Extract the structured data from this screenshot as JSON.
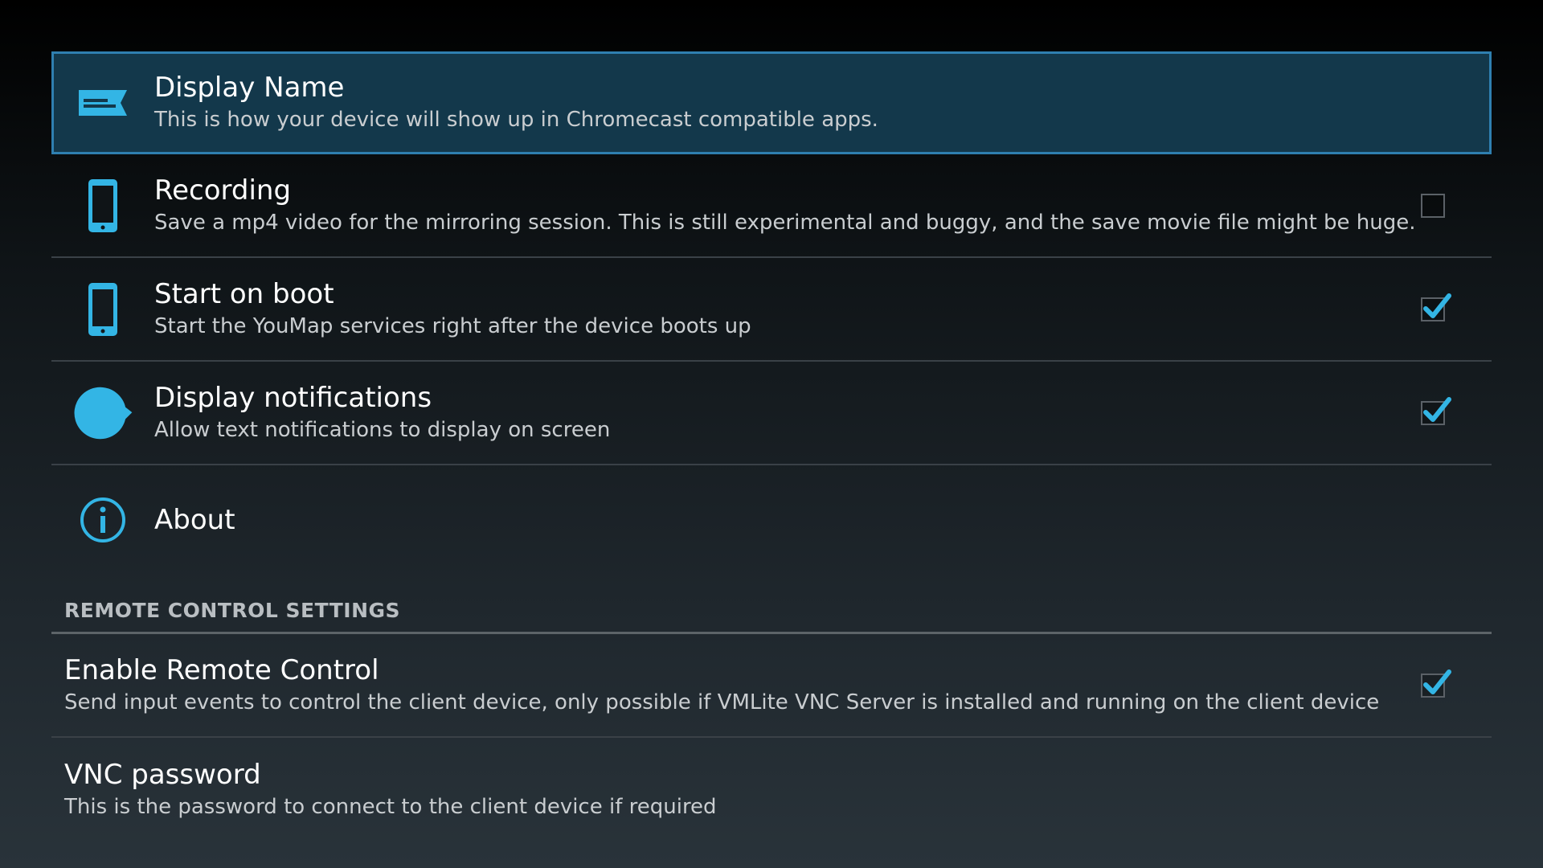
{
  "settings": {
    "items": [
      {
        "title": "Display Name",
        "summary": "This is how your device will show up in Chromecast compatible apps.",
        "icon": "label-icon"
      },
      {
        "title": "Recording",
        "summary": "Save a mp4 video for the mirroring session. This is still experimental and buggy, and the save movie file might be huge.",
        "icon": "phone-icon",
        "checked": false
      },
      {
        "title": "Start on boot",
        "summary": "Start the YouMap services right after the device boots up",
        "icon": "phone-icon",
        "checked": true
      },
      {
        "title": "Display notifications",
        "summary": "Allow text notifications to display on screen",
        "icon": "chat-bubble-icon",
        "checked": true
      },
      {
        "title": "About",
        "icon": "info-icon"
      }
    ]
  },
  "remote_section": {
    "header": "REMOTE CONTROL SETTINGS",
    "items": [
      {
        "title": "Enable Remote Control",
        "summary": "Send input events to control the client device, only possible if VMLite VNC Server is installed and running on the client device",
        "checked": true
      },
      {
        "title": "VNC password",
        "summary": "This is the password to connect to the client device if required"
      }
    ]
  },
  "colors": {
    "accent": "#33b5e5",
    "selected_bg": "#13384b",
    "selected_border": "#2f7fb0"
  }
}
